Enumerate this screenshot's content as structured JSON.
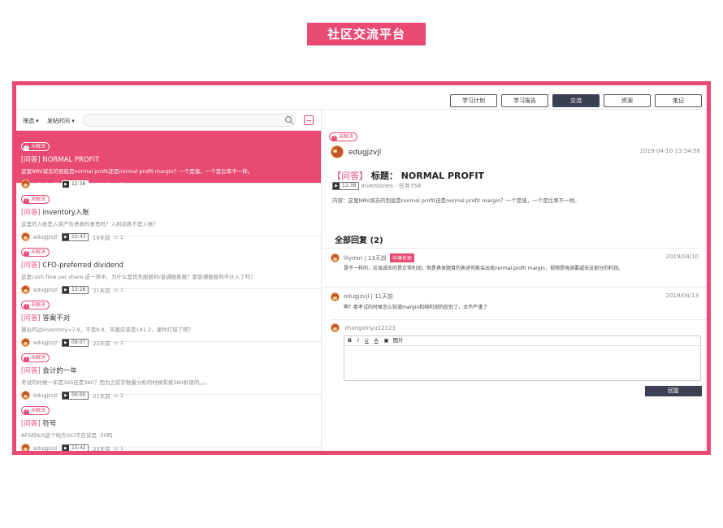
{
  "banner": "社区交流平台",
  "nav": {
    "tabs": [
      "学习计划",
      "学习报告",
      "交流",
      "资源",
      "笔记"
    ],
    "active": "交流"
  },
  "filters": {
    "filter_label": "筛选",
    "time_label": "发帖时间"
  },
  "unresolved": "未解决",
  "questions": [
    {
      "tag": "[问答]",
      "title": " NORMAL PROFIT",
      "excerpt": "这里NRV减去的到底是normal profit还是normal profit margin？一个是值，一个是比率不一样。",
      "user": "edugjzvjl",
      "video": "12:38",
      "days": "13天前",
      "comments": "2"
    },
    {
      "tag": "[问答]",
      "title": " inventory入账",
      "excerpt": "这里的入账是入资产负债表的意思吗？入利润表不是入账？",
      "user": "edugjzvjl",
      "video": "10:43",
      "days": "19天前",
      "comments": "1"
    },
    {
      "tag": "[问答]",
      "title": " CFO-preferred dividend",
      "excerpt": "这里cash flow per share 这一项中，为什么是优先股股利/普通股股数？那普通股股利不计入了吗？",
      "user": "edugjzvjl",
      "video": "13:28",
      "days": "21天前",
      "comments": "1"
    },
    {
      "tag": "[问答]",
      "title": " 答案不对",
      "excerpt": "算出的边inventory=7.9，不是8.8，答案应该是181.2，课件打错了吧？",
      "user": "edugjzvjl",
      "video": "09:07",
      "days": "22天前",
      "comments": "2"
    },
    {
      "tag": "[问答]",
      "title": " 会计的一年",
      "excerpt": "考试的时候一年是365还是360？因为之前学数量分析的时候有按360折现的。。。",
      "user": "edugjzvjl",
      "video": "00:00",
      "days": "21天前",
      "comments": "1"
    },
    {
      "tag": "[问答]",
      "title": " 符号",
      "excerpt": "AFS的B/S这个地方OCI不应该是 -50吗",
      "user": "edugjzvjl",
      "video": "15:42",
      "days": "23天前",
      "comments": "1"
    }
  ],
  "detail": {
    "user": "edugjzvjl",
    "date": "2019-04-10 13:54:58",
    "tag": "【问答】",
    "title": "标题： NORMAL PROFIT",
    "video": "12:38",
    "source": "Inventories - 任务758",
    "content": "内容：这里NRV减去的到底是normal profit还是normal profit margin？一个是值，一个是比率不一样。"
  },
  "replies_header": "全部回复 (2)",
  "replies": [
    {
      "user": "lilymin",
      "days": "13天前",
      "badge": "中博名师",
      "date": "2019/04/10",
      "text": "是不一样的，应该减去的是正常利润，但是具体题目的表述可能会出现normal profit margin，视频是强调要减去这部分的利润。"
    },
    {
      "user": "edugjzvjl",
      "days": "11天前",
      "badge": "",
      "date": "2019/04/13",
      "text": "啊？那考试的时候怎么知道margin和纯利润的区别了，太不严谨了"
    }
  ],
  "composer": {
    "user": "zhangxinyu12123",
    "toolbar": [
      "B",
      "I",
      "U",
      "A",
      "图片"
    ],
    "submit": "回复"
  }
}
